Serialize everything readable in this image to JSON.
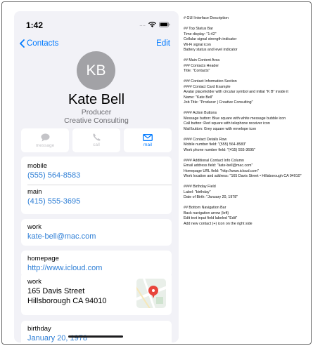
{
  "status_bar": {
    "time": "1:42",
    "dots": "...."
  },
  "nav": {
    "back_label": "Contacts",
    "edit_label": "Edit"
  },
  "contact": {
    "initials": "KB",
    "name": "Kate Bell",
    "job_title": "Producer",
    "company": "Creative Consulting"
  },
  "actions": {
    "message": "message",
    "call": "call",
    "mail": "mail"
  },
  "colors": {
    "accent": "#007aff",
    "link": "#2f7fd6",
    "avatar": "#a2a2a6",
    "background": "#f2f2f7",
    "map_pin": "#e8453c"
  },
  "phones": [
    {
      "label": "mobile",
      "value": "(555) 564-8583"
    },
    {
      "label": "main",
      "value": "(415) 555-3695"
    }
  ],
  "email": {
    "label": "work",
    "value": "kate-bell@mac.com"
  },
  "homepage": {
    "label": "homepage",
    "value": "http://www.icloud.com"
  },
  "address": {
    "label": "work",
    "street": "165 Davis Street",
    "city": "Hillsborough CA 94010"
  },
  "birthday": {
    "label": "birthday",
    "value": "January 20, 1978"
  },
  "description": [
    "# GUI Interface Description",
    "",
    "## Top Status Bar",
    "Time display: \"1:42\"",
    "Cellular signal strength indicator",
    "Wi-Fi signal icon",
    "Battery status and level indicator",
    "",
    "## Main Content Area",
    "### Contacts Header",
    "Title: \"Contacts\"",
    "",
    "### Contact Information Section",
    "#### Contact Card Example",
    "Avatar placeholder with circular symbol and initial \"K B\" inside it",
    "Name: \"Kate Bell\"",
    "Job Title: \"Producer | Creative Consulting\"",
    "",
    "#### Action Buttons",
    "Message button: Blue square with white message bubble icon",
    "Call button: Red square with telephone receiver icon",
    "Mail button: Grey square with envelope icon",
    "",
    "#### Contact Details Row",
    "Mobile number field: \"(555) 564-8583\"",
    "Work phone number field: \"(415) 555-3695\"",
    "",
    "#### Additional Contact Info Column",
    "Email address field: \"kate-bell@mac.com\"",
    "Homepage URL field: \"http://www.icloud.com\"",
    "Work location and address: \"165 Davis Street • Hillsborough CA 94010\"",
    "",
    "#### Birthday Field",
    "Label: \"birthday\"",
    "Date of Birth: \"January 20, 1978\"",
    "",
    "## Bottom Navigation Bar",
    "Back navigation arrow (left)",
    "Edit text input field labeled \"Edit\"",
    "Add new contact (+) icon on the right side"
  ]
}
